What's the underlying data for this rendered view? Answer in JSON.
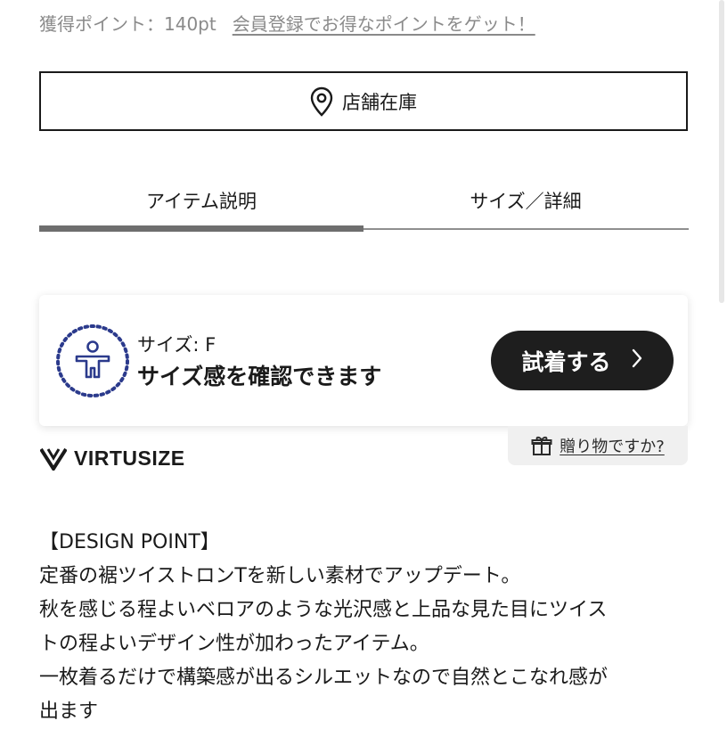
{
  "points": {
    "earned": "獲得ポイント：140pt",
    "register_link": "会員登録でお得なポイントをゲット！"
  },
  "store_stock": {
    "label": "店舗在庫",
    "icon": "location-pin-icon"
  },
  "tabs": [
    {
      "label": "アイテム説明",
      "active": true
    },
    {
      "label": "サイズ／詳細",
      "active": false
    }
  ],
  "virtusize": {
    "size_label": "サイズ: F",
    "message": "サイズ感を確認できます",
    "try_button": "試着する",
    "brand": "VIRTUSIZE",
    "icon": "person-icon"
  },
  "gift": {
    "label": "贈り物ですか?",
    "icon": "gift-icon"
  },
  "description": {
    "heading": "【DESIGN POINT】",
    "lines": [
      "定番の裾ツイストロンTを新しい素材でアップデート。",
      "秋を感じる程よいベロアのような光沢感と上品な見た目にツイス",
      "トの程よいデザイン性が加わったアイテム。",
      "一枚着るだけで構築感が出るシルエットなので自然とこなれ感が",
      "出ます"
    ]
  },
  "colors": {
    "accent_dark": "#1e1e1e",
    "virtusize_blue": "#2b3a8c"
  }
}
